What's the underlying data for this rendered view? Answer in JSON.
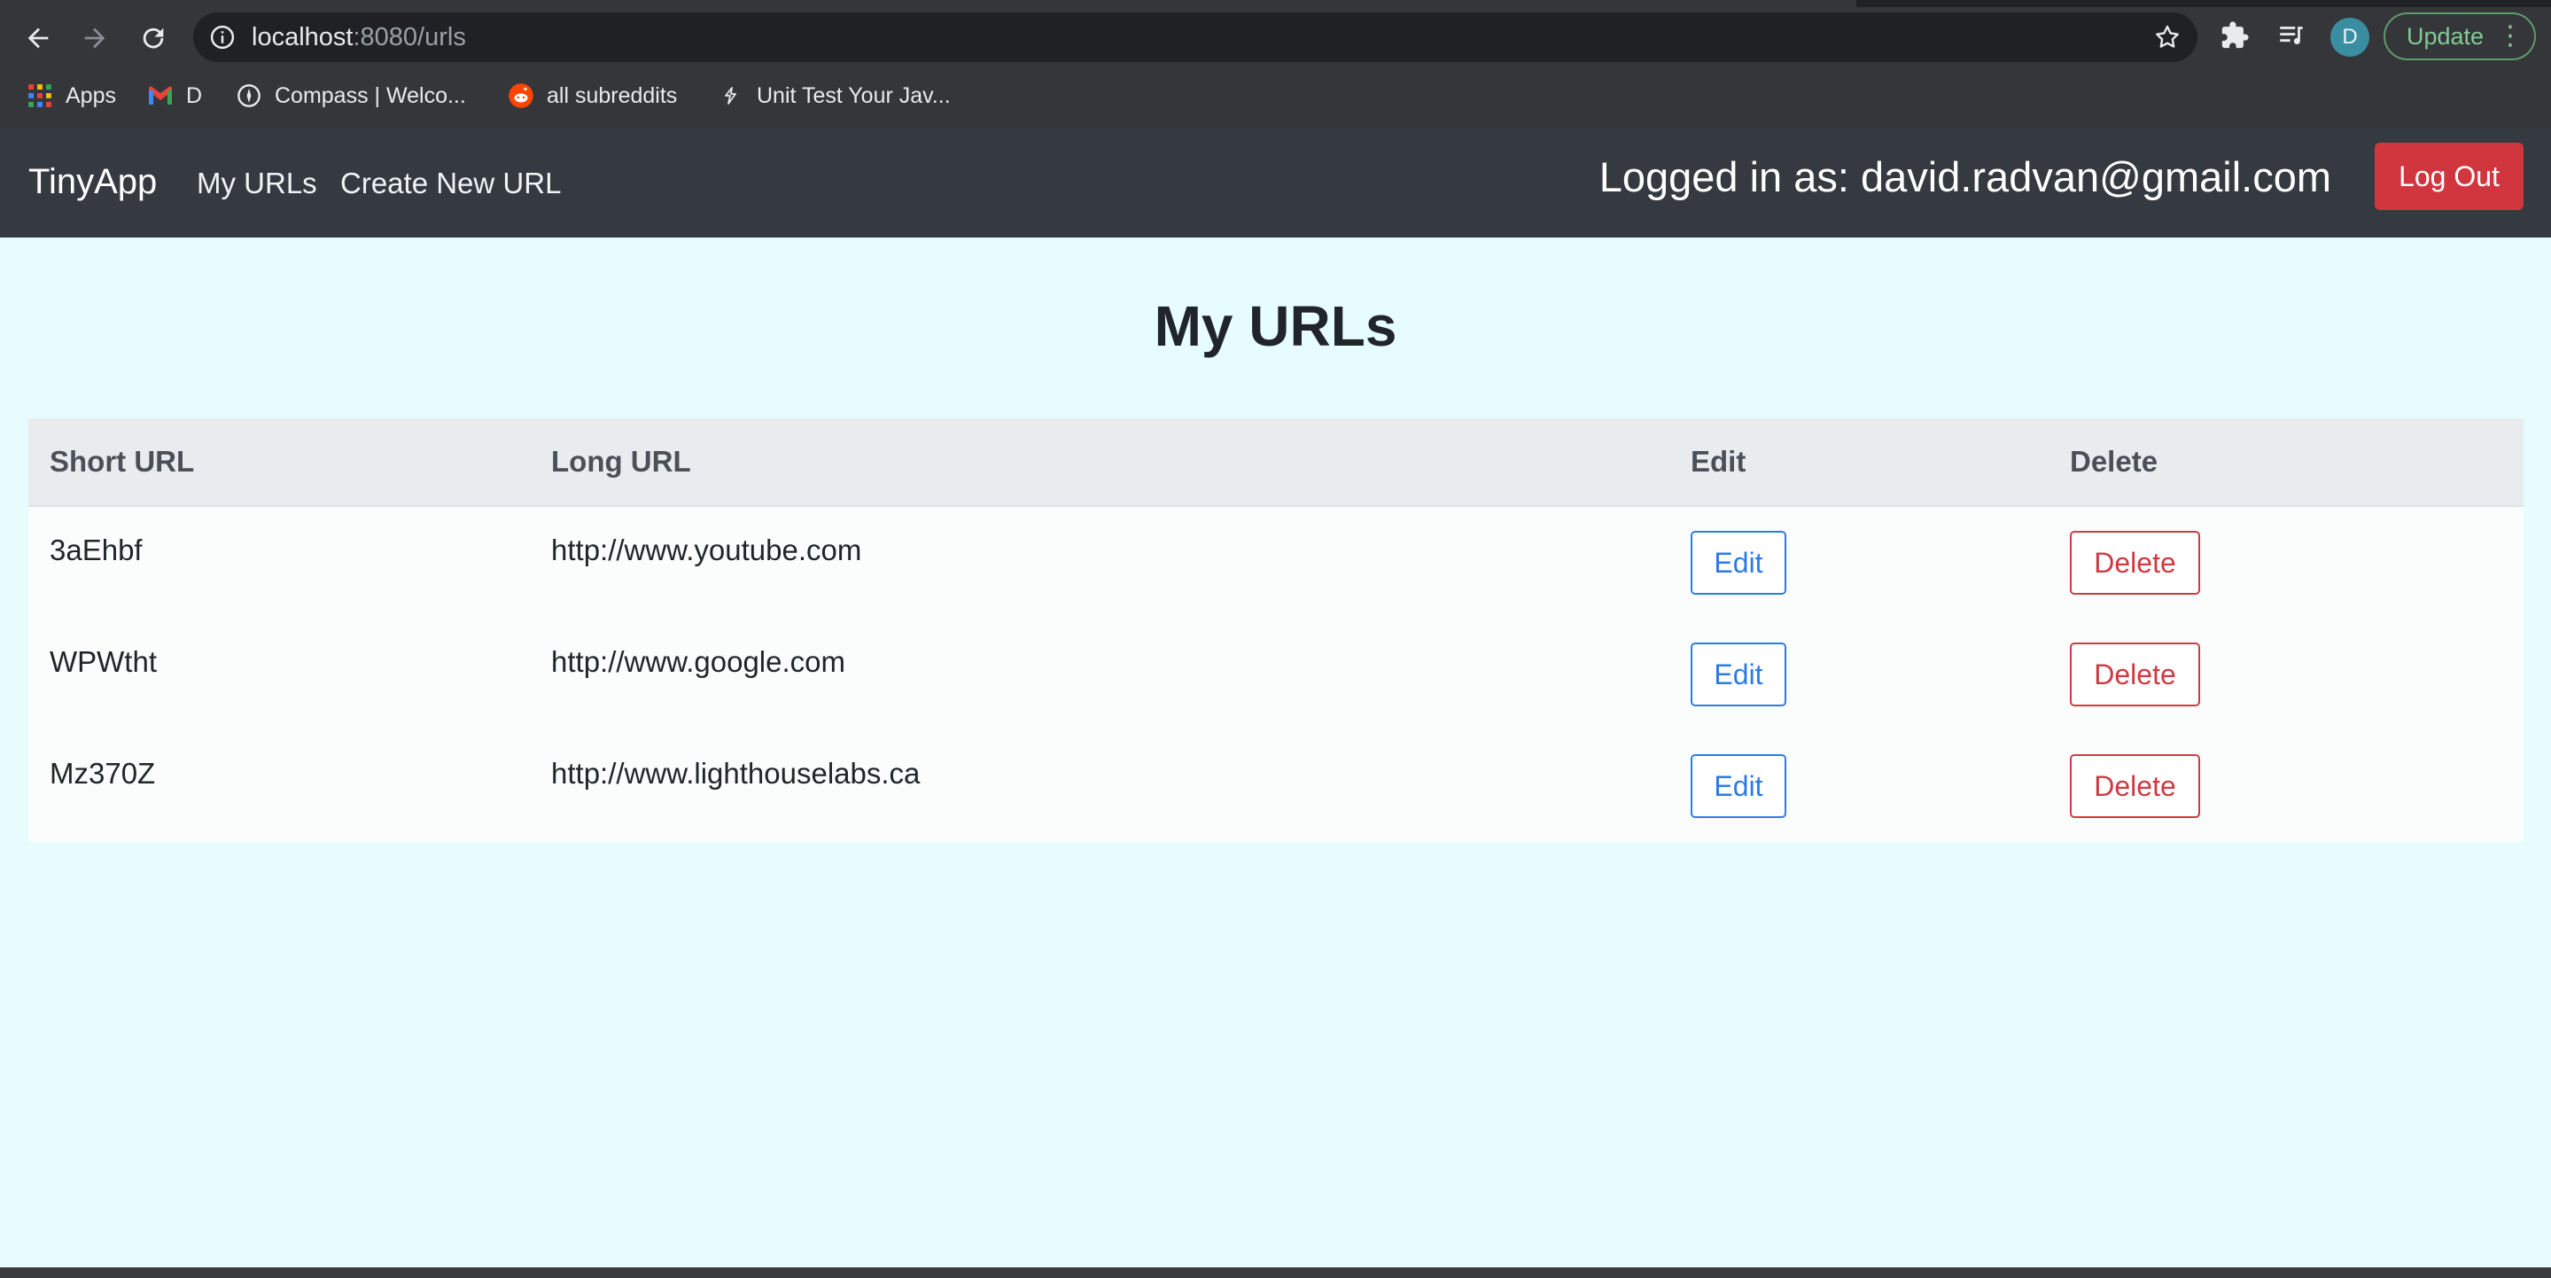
{
  "browser": {
    "url_host": "localhost",
    "url_path": ":8080/urls",
    "bookmarks": [
      {
        "label": "Apps",
        "icon": "apps-grid-icon"
      },
      {
        "label": "D",
        "icon": "gmail-icon"
      },
      {
        "label": "Compass | Welco...",
        "icon": "compass-icon"
      },
      {
        "label": "all subreddits",
        "icon": "reddit-icon"
      },
      {
        "label": "Unit Test Your Jav...",
        "icon": "bookmark-icon"
      }
    ],
    "profile_initial": "D",
    "update_label": "Update",
    "colors": {
      "chrome": "#35363a",
      "omnibox": "#202124",
      "update": "#81c995"
    }
  },
  "navbar": {
    "brand": "TinyApp",
    "links": [
      "My URLs",
      "Create New URL"
    ],
    "logged_in_text": "Logged in as: david.radvan@gmail.com",
    "logout_label": "Log Out",
    "colors": {
      "background": "#343a40",
      "logout": "#d1363f"
    }
  },
  "main": {
    "title": "My URLs",
    "table": {
      "headers": [
        "Short URL",
        "Long URL",
        "Edit",
        "Delete"
      ],
      "rows": [
        {
          "short": "3aEhbf",
          "long": "http://www.youtube.com",
          "edit": "Edit",
          "delete": "Delete"
        },
        {
          "short": "WPWtht",
          "long": "http://www.google.com",
          "edit": "Edit",
          "delete": "Delete"
        },
        {
          "short": "Mz370Z",
          "long": "http://www.lighthouselabs.ca",
          "edit": "Edit",
          "delete": "Delete"
        }
      ]
    },
    "colors": {
      "page_background": "#e6fcfd",
      "edit": "#2c7be5",
      "delete": "#cf3a42"
    }
  }
}
